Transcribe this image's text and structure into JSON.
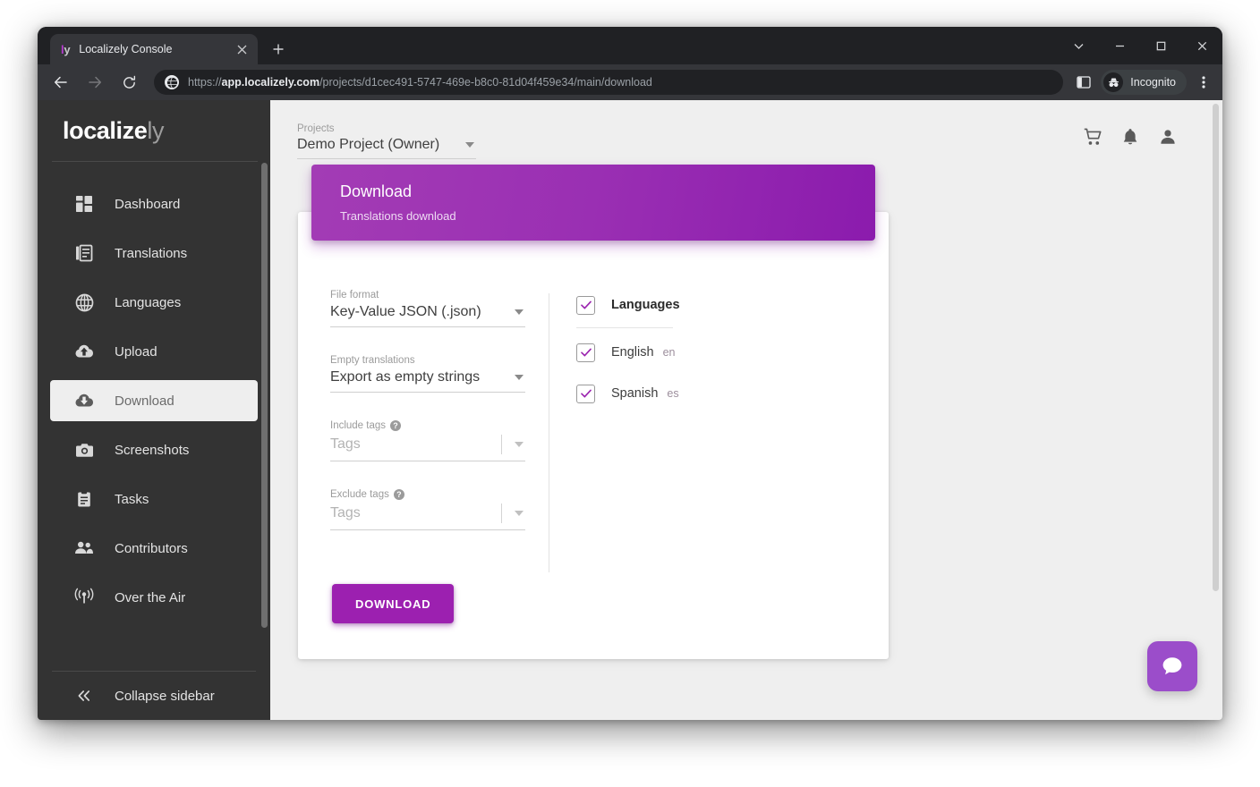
{
  "browser": {
    "tab": {
      "favicon_left": "l",
      "favicon_right": "y",
      "title": "Localizely Console",
      "close_icon": "close-icon"
    },
    "new_tab_label": "+",
    "window_controls": [
      "chevron-down",
      "minimize",
      "maximize",
      "close"
    ],
    "url": {
      "scheme": "https://",
      "host": "app.localizely.com",
      "path": "/projects/d1cec491-5747-469e-b8c0-81d04f459e34/main/download"
    },
    "incognito_label": "Incognito"
  },
  "sidebar": {
    "logo_bold": "localize",
    "logo_light": "ly",
    "items": [
      {
        "label": "Dashboard",
        "icon": "dashboard-icon",
        "active": false
      },
      {
        "label": "Translations",
        "icon": "translations-icon",
        "active": false
      },
      {
        "label": "Languages",
        "icon": "globe-icon",
        "active": false
      },
      {
        "label": "Upload",
        "icon": "cloud-upload-icon",
        "active": false
      },
      {
        "label": "Download",
        "icon": "cloud-download-icon",
        "active": true
      },
      {
        "label": "Screenshots",
        "icon": "camera-icon",
        "active": false
      },
      {
        "label": "Tasks",
        "icon": "clipboard-icon",
        "active": false
      },
      {
        "label": "Contributors",
        "icon": "people-icon",
        "active": false
      },
      {
        "label": "Over the Air",
        "icon": "broadcast-icon",
        "active": false
      }
    ],
    "collapse_label": "Collapse sidebar"
  },
  "topbar": {
    "projects_label": "Projects",
    "project_value": "Demo Project (Owner)",
    "actions": [
      "cart-icon",
      "bell-icon",
      "account-icon"
    ]
  },
  "panel": {
    "title": "Download",
    "subtitle": "Translations download"
  },
  "form": {
    "file_format": {
      "label": "File format",
      "value": "Key-Value JSON (.json)"
    },
    "empty_translations": {
      "label": "Empty translations",
      "value": "Export as empty strings"
    },
    "include_tags": {
      "label": "Include tags",
      "help": "?",
      "placeholder": "Tags"
    },
    "exclude_tags": {
      "label": "Exclude tags",
      "help": "?",
      "placeholder": "Tags"
    },
    "download_button": "DOWNLOAD"
  },
  "languages": {
    "header_label": "Languages",
    "header_checked": true,
    "items": [
      {
        "name": "English",
        "code": "en",
        "checked": true
      },
      {
        "name": "Spanish",
        "code": "es",
        "checked": true
      }
    ]
  },
  "colors": {
    "accent": "#9c20b0",
    "header_gradient_start": "#a33cb5",
    "header_gradient_end": "#8b1bad",
    "sidebar_bg": "#333333",
    "page_bg": "#efefef",
    "chat_fab": "#9b4dca"
  }
}
